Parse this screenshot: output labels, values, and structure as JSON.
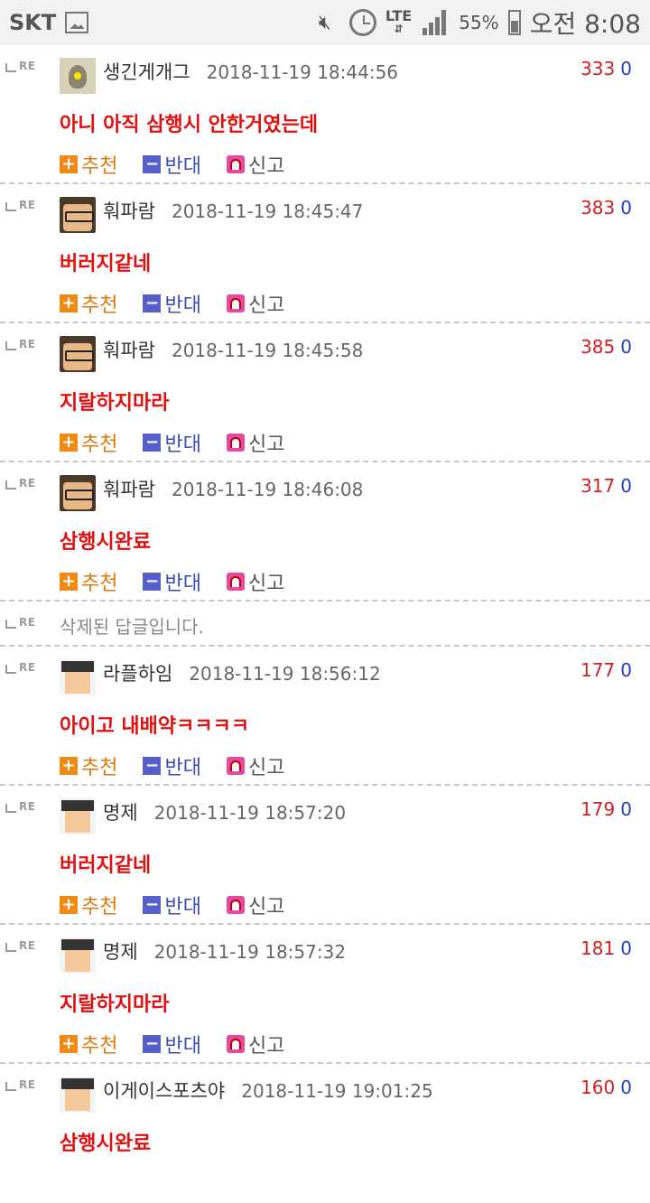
{
  "status_bar": {
    "carrier": "SKT",
    "network": "LTE",
    "battery": "55%",
    "time": "오전 8:08",
    "icons": [
      "gallery-icon",
      "mute-icon",
      "alarm-icon",
      "lte-icon",
      "signal-icon",
      "battery-icon"
    ]
  },
  "re_label": "RE",
  "actions": {
    "recommend": "추천",
    "oppose": "반대",
    "report": "신고"
  },
  "comments": [
    {
      "nick": "생긴게개그",
      "date": "2018-11-19 18:44:56",
      "up": "333",
      "down": "0",
      "text": "아니 아직 삼행시 안한거였는데"
    },
    {
      "nick": "훠파람",
      "date": "2018-11-19 18:45:47",
      "up": "383",
      "down": "0",
      "text": "버러지같네"
    },
    {
      "nick": "훠파람",
      "date": "2018-11-19 18:45:58",
      "up": "385",
      "down": "0",
      "text": "지랄하지마라"
    },
    {
      "nick": "훠파람",
      "date": "2018-11-19 18:46:08",
      "up": "317",
      "down": "0",
      "text": "삼행시완료"
    },
    {
      "deleted": "삭제된 답글입니다."
    },
    {
      "nick": "라플하임",
      "date": "2018-11-19 18:56:12",
      "up": "177",
      "down": "0",
      "text": "아이고 내배약ㅋㅋㅋㅋ"
    },
    {
      "nick": "명제",
      "date": "2018-11-19 18:57:20",
      "up": "179",
      "down": "0",
      "text": "버러지같네"
    },
    {
      "nick": "명제",
      "date": "2018-11-19 18:57:32",
      "up": "181",
      "down": "0",
      "text": "지랄하지마라"
    },
    {
      "nick": "이게이스포츠야",
      "date": "2018-11-19 19:01:25",
      "up": "160",
      "down": "0",
      "text": "삼행시완료"
    }
  ]
}
